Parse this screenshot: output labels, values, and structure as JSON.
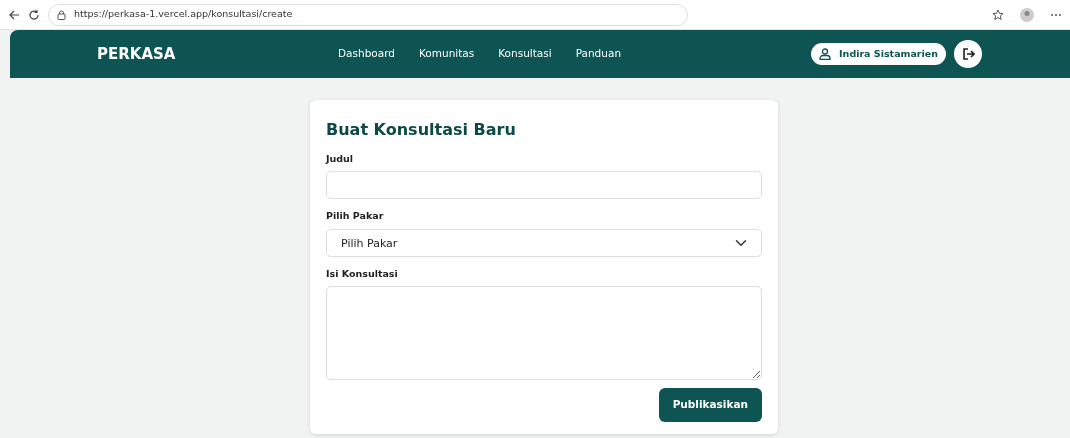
{
  "browser": {
    "url": "https://perkasa-1.vercel.app/konsultasi/create"
  },
  "navbar": {
    "brand": "PERKASA",
    "links": [
      {
        "label": "Dashboard"
      },
      {
        "label": "Komunitas"
      },
      {
        "label": "Konsultasi"
      },
      {
        "label": "Panduan"
      }
    ],
    "user": "Indira Sistamarien"
  },
  "form": {
    "title": "Buat Konsultasi Baru",
    "fields": [
      {
        "kind": "text",
        "label": "Judul"
      },
      {
        "kind": "select",
        "label": "Pilih Pakar",
        "value": "Pilih Pakar"
      },
      {
        "kind": "textarea",
        "label": "Isi Konsultasi"
      }
    ],
    "submit": "Publikasikan"
  }
}
